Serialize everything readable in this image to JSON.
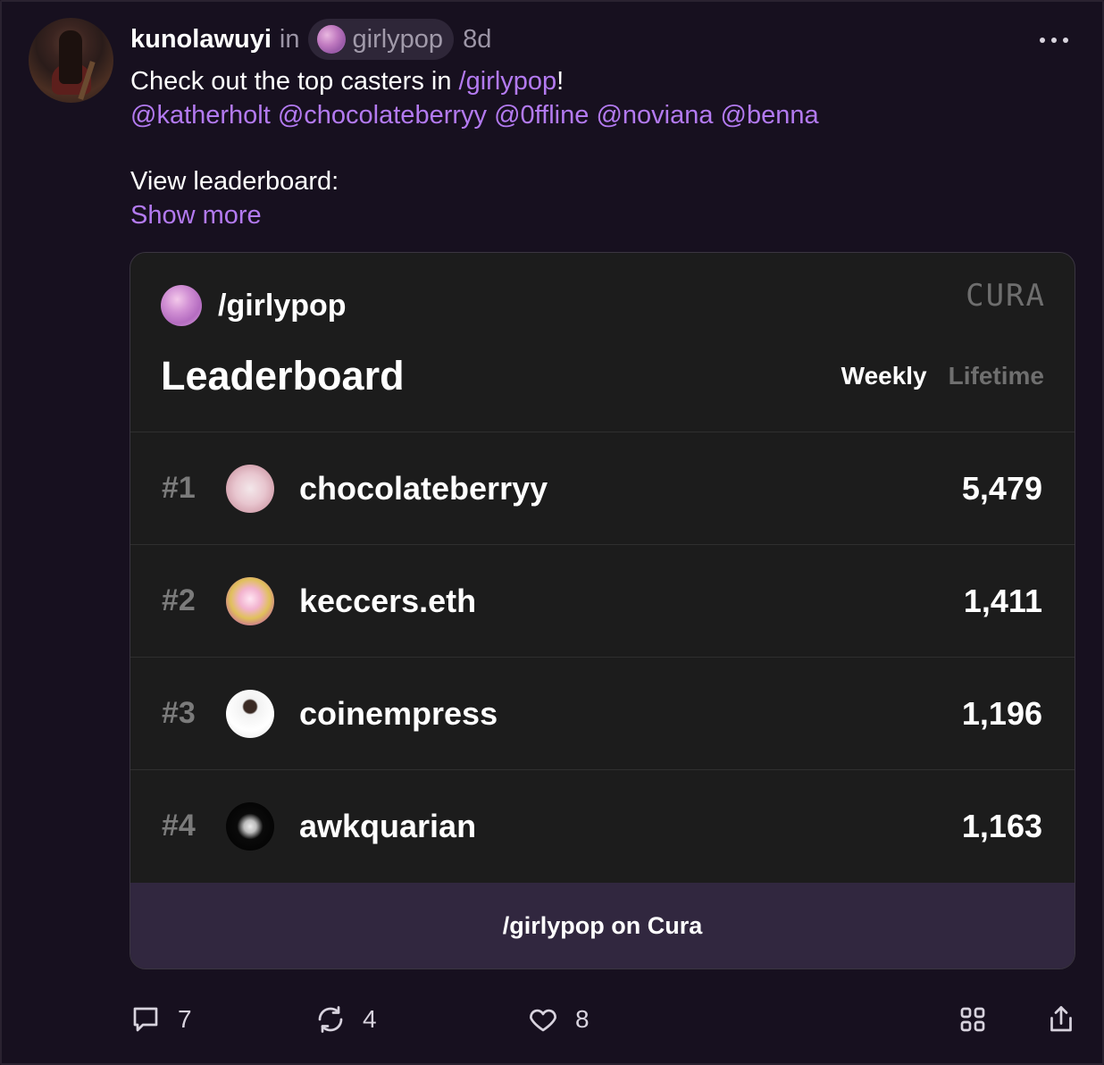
{
  "post": {
    "author": "kunolawuyi",
    "in_label": "in",
    "channel": "girlypop",
    "age": "8d",
    "text_prefix": "Check out the top casters in ",
    "channel_link": "/girlypop",
    "text_suffix": "!",
    "mentions": [
      "@katherholt",
      "@chocolateberryy",
      "@0ffline",
      "@noviana",
      "@benna"
    ],
    "view_leaderboard": "View leaderboard:",
    "show_more": "Show more"
  },
  "card": {
    "channel_name": "/girlypop",
    "brand": "CURA",
    "title": "Leaderboard",
    "tabs": [
      {
        "label": "Weekly",
        "active": true
      },
      {
        "label": "Lifetime",
        "active": false
      }
    ],
    "rows": [
      {
        "rank": "#1",
        "name": "chocolateberryy",
        "score": "5,479"
      },
      {
        "rank": "#2",
        "name": "keccers.eth",
        "score": "1,411"
      },
      {
        "rank": "#3",
        "name": "coinempress",
        "score": "1,196"
      },
      {
        "rank": "#4",
        "name": "awkquarian",
        "score": "1,163"
      }
    ],
    "footer": "/girlypop on Cura"
  },
  "actions": {
    "comments": "7",
    "recasts": "4",
    "likes": "8"
  },
  "icons": {
    "comment": "comment-icon",
    "recast": "recast-icon",
    "like": "heart-icon",
    "grid": "grid-icon",
    "share": "share-icon",
    "more": "more-dots-icon"
  },
  "colors": {
    "background": "#17101f",
    "link": "#b37af0",
    "card": "#1c1c1c",
    "card_footer": "#31273f"
  }
}
